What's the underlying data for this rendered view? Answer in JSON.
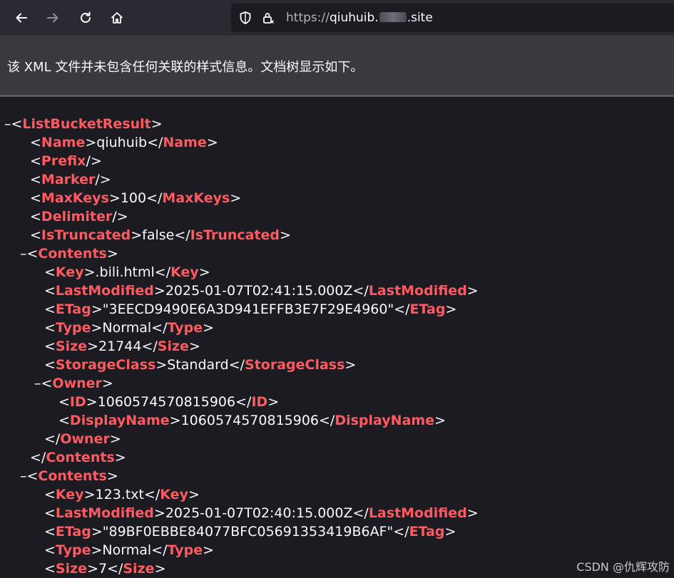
{
  "browser": {
    "url_prefix": "https://",
    "url_host_start": "qiuhuib.",
    "url_host_end": ".site"
  },
  "info_message": "该 XML 文件并未包含任何关联的样式信息。文档树显示如下。",
  "xml": {
    "root_tag": "ListBucketResult",
    "name_tag": "Name",
    "name_value": "qiuhuib",
    "prefix_tag": "Prefix",
    "marker_tag": "Marker",
    "maxkeys_tag": "MaxKeys",
    "maxkeys_value": "100",
    "delimiter_tag": "Delimiter",
    "istruncated_tag": "IsTruncated",
    "istruncated_value": "false",
    "contents_tag": "Contents",
    "key_tag": "Key",
    "lastmodified_tag": "LastModified",
    "etag_tag": "ETag",
    "type_tag": "Type",
    "size_tag": "Size",
    "storageclass_tag": "StorageClass",
    "owner_tag": "Owner",
    "id_tag": "ID",
    "displayname_tag": "DisplayName",
    "contents": [
      {
        "key": ".bili.html",
        "last_modified": "2025-01-07T02:41:15.000Z",
        "etag": "\"3EECD9490E6A3D941EFFB3E7F29E4960\"",
        "type": "Normal",
        "size": "21744",
        "storage_class": "Standard",
        "owner_id": "1060574570815906",
        "owner_display_name": "1060574570815906"
      },
      {
        "key": "123.txt",
        "last_modified": "2025-01-07T02:40:15.000Z",
        "etag": "\"89BF0EBBE84077BFC05691353419B6AF\"",
        "type": "Normal",
        "size": "7"
      }
    ]
  },
  "watermark": "CSDN @仇辉攻防",
  "icons": [
    "back-arrow-icon",
    "forward-arrow-icon",
    "reload-icon",
    "home-icon",
    "shield-icon",
    "lock-icon",
    "collapse-toggle-icon"
  ]
}
